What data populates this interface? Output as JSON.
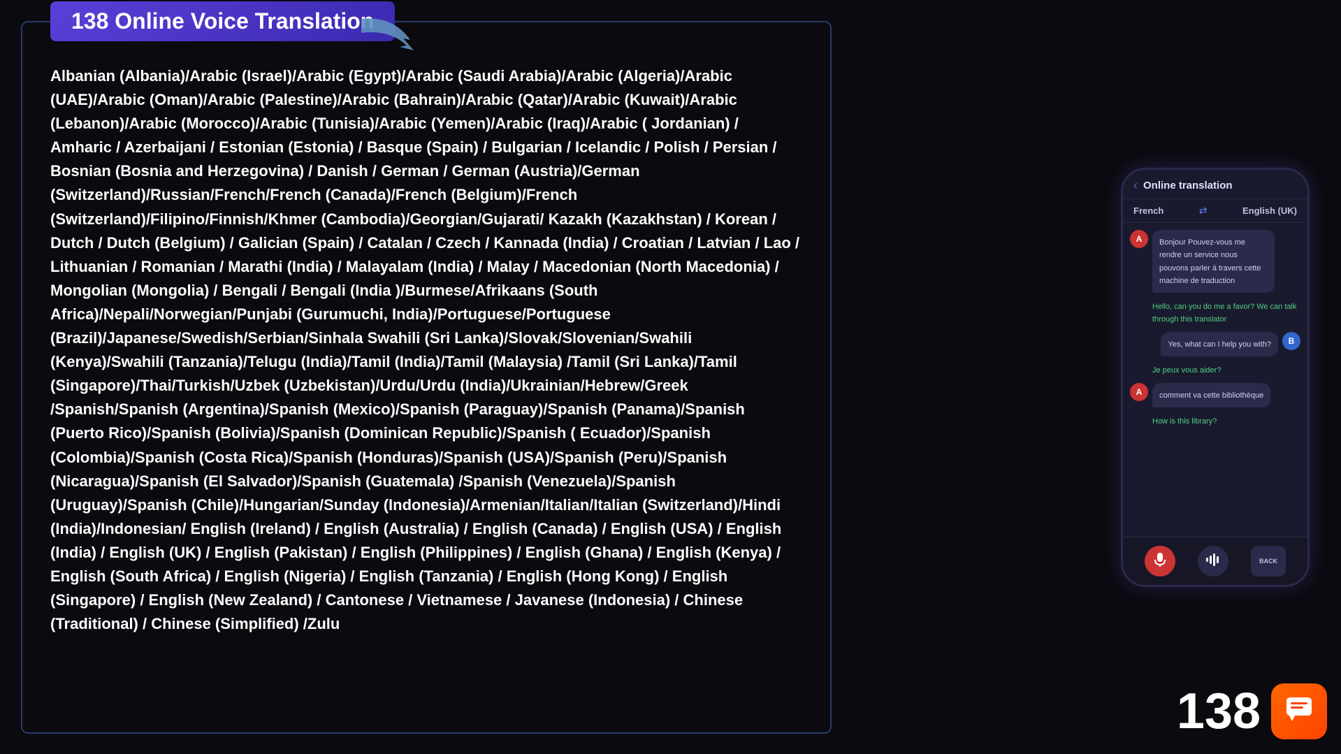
{
  "background_color": "#0a0a0f",
  "title": {
    "text": "138 Online Voice Translation",
    "badge_text": "138 Online Voice Translation"
  },
  "languages": {
    "content": "Albanian (Albania)/Arabic (Israel)/Arabic (Egypt)/Arabic (Saudi Arabia)/Arabic (Algeria)/Arabic (UAE)/Arabic (Oman)/Arabic (Palestine)/Arabic (Bahrain)/Arabic (Qatar)/Arabic (Kuwait)/Arabic (Lebanon)/Arabic (Morocco)/Arabic (Tunisia)/Arabic (Yemen)/Arabic (Iraq)/Arabic ( Jordanian) / Amharic / Azerbaijani / Estonian (Estonia) / Basque (Spain) / Bulgarian / Icelandic / Polish / Persian / Bosnian (Bosnia and Herzegovina) / Danish / German / German (Austria)/German (Switzerland)/Russian/French/French (Canada)/French (Belgium)/French (Switzerland)/Filipino/Finnish/Khmer (Cambodia)/Georgian/Gujarati/ Kazakh (Kazakhstan) / Korean / Dutch / Dutch (Belgium) / Galician (Spain) / Catalan / Czech / Kannada (India) / Croatian / Latvian / Lao / Lithuanian / Romanian / Marathi (India) / Malayalam (India) / Malay / Macedonian (North Macedonia) / Mongolian (Mongolia) / Bengali / Bengali (India )/Burmese/Afrikaans (South Africa)/Nepali/Norwegian/Punjabi (Gurumuchi, India)/Portuguese/Portuguese (Brazil)/Japanese/Swedish/Serbian/Sinhala Swahili (Sri Lanka)/Slovak/Slovenian/Swahili (Kenya)/Swahili (Tanzania)/Telugu (India)/Tamil (India)/Tamil (Malaysia) /Tamil (Sri Lanka)/Tamil (Singapore)/Thai/Turkish/Uzbek (Uzbekistan)/Urdu/Urdu (India)/Ukrainian/Hebrew/Greek /Spanish/Spanish (Argentina)/Spanish (Mexico)/Spanish (Paraguay)/Spanish (Panama)/Spanish (Puerto Rico)/Spanish (Bolivia)/Spanish (Dominican Republic)/Spanish ( Ecuador)/Spanish (Colombia)/Spanish (Costa Rica)/Spanish (Honduras)/Spanish (USA)/Spanish (Peru)/Spanish (Nicaragua)/Spanish (El Salvador)/Spanish (Guatemala) /Spanish (Venezuela)/Spanish (Uruguay)/Spanish (Chile)/Hungarian/Sunday (Indonesia)/Armenian/Italian/Italian (Switzerland)/Hindi (India)/Indonesian/ English (Ireland) / English (Australia) / English (Canada) / English (USA) / English (India) / English (UK) / English (Pakistan) / English (Philippines) / English (Ghana) / English (Kenya) / English (South Africa) / English (Nigeria) / English (Tanzania) / English (Hong Kong) / English (Singapore) / English (New Zealand) / Cantonese / Vietnamese / Javanese (Indonesia) / Chinese (Traditional) / Chinese (Simplified) /Zulu"
  },
  "phone": {
    "back_label": "‹",
    "title": "Online translation",
    "lang_from": "French",
    "swap_icon": "⇄",
    "lang_to": "English (UK)",
    "messages": [
      {
        "sender": "A",
        "type": "left",
        "text": "Bonjour Pouvez-vous me rendre un service nous pouvons parler à travers cette machine de traduction",
        "color": "dark"
      },
      {
        "sender": null,
        "type": "right-green",
        "text": "Hello, can you do me a favor? We can talk through this translator",
        "color": "green"
      },
      {
        "sender": "B",
        "type": "right",
        "text": "Yes, what can I help you with?",
        "color": "dark"
      },
      {
        "sender": null,
        "type": "left-green",
        "text": "Je peux vous aider?",
        "color": "green"
      },
      {
        "sender": "A",
        "type": "left",
        "text": "comment va cette bibliothèque",
        "color": "dark"
      },
      {
        "sender": null,
        "type": "right-green",
        "text": "How is this library?",
        "color": "green"
      }
    ],
    "controls": [
      {
        "label": "",
        "icon": "🎤",
        "active": true
      },
      {
        "label": "",
        "icon": "📊",
        "active": false
      },
      {
        "label": "BACK",
        "icon": "",
        "active": false
      }
    ]
  },
  "bottom_number": "138",
  "icons": {
    "chat_icon": "💬"
  }
}
